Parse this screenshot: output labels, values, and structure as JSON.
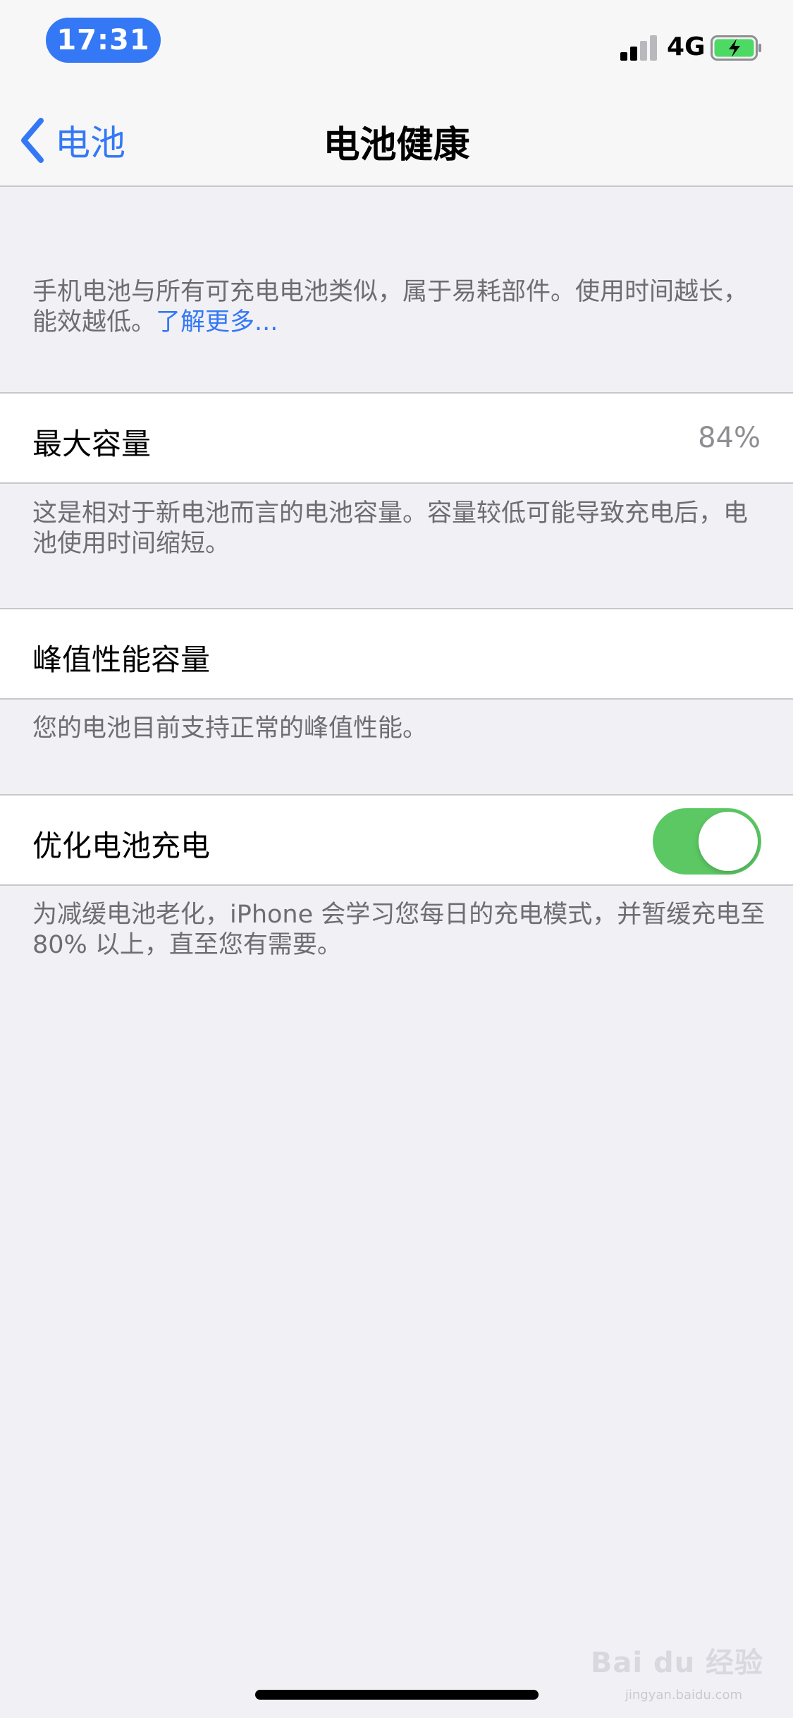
{
  "status_bar": {
    "time": "17:31",
    "network": "4G",
    "time_pill_color": "#3478f6",
    "battery_icon": "battery-charging-icon",
    "signal_icon": "cellular-signal-icon"
  },
  "nav": {
    "back_label": "电池",
    "title": "电池健康"
  },
  "intro": {
    "text": "手机电池与所有可充电电池类似，属于易耗部件。使用时间越长，能效越低。",
    "link": "了解更多..."
  },
  "max_capacity": {
    "label": "最大容量",
    "value": "84%",
    "note": "这是相对于新电池而言的电池容量。容量较低可能导致充电后，电池使用时间缩短。"
  },
  "peak_performance": {
    "label": "峰值性能容量",
    "note": "您的电池目前支持正常的峰值性能。"
  },
  "optimized_charging": {
    "label": "优化电池充电",
    "enabled": true,
    "toggle_color": "#5cc863",
    "note": "为减缓电池老化，iPhone 会学习您每日的充电模式，并暂缓充电至 80% 以上，直至您有需要。"
  },
  "watermark": {
    "text": "Bai du 经验",
    "sub": "jingyan.baidu.com"
  }
}
